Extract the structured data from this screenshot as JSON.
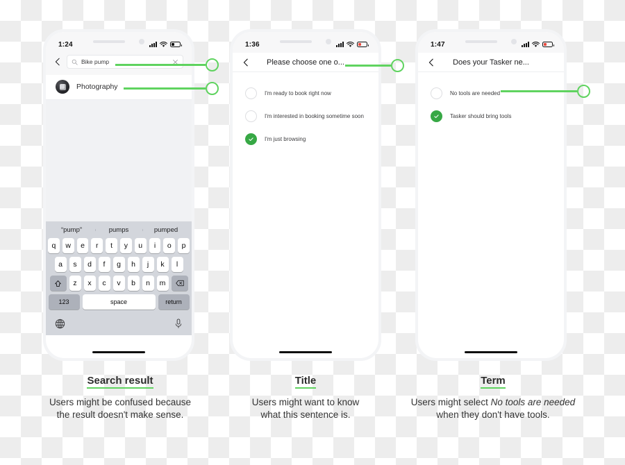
{
  "annotation_color": "#5fd35f",
  "phones": [
    {
      "id": "phone-search",
      "status": {
        "time": "1:24",
        "battery_color": "#111111"
      },
      "search": {
        "value": "Bike pump",
        "placeholder": "Search",
        "back_icon": "chevron-left-icon",
        "search_icon": "search-icon",
        "clear_icon": "close-icon"
      },
      "result": {
        "label": "Photography",
        "avatar_icon": "camera-avatar-icon"
      },
      "keyboard": {
        "predictions": [
          "“pump”",
          "pumps",
          "pumped"
        ],
        "row1": [
          "q",
          "w",
          "e",
          "r",
          "t",
          "y",
          "u",
          "i",
          "o",
          "p"
        ],
        "row2": [
          "a",
          "s",
          "d",
          "f",
          "g",
          "h",
          "j",
          "k",
          "l"
        ],
        "row3": [
          "z",
          "x",
          "c",
          "v",
          "b",
          "n",
          "m"
        ],
        "shift_icon": "shift-icon",
        "backspace_icon": "backspace-icon",
        "numbers_key": "123",
        "space_key": "space",
        "return_key": "return",
        "globe_icon": "globe-icon",
        "mic_icon": "microphone-icon"
      }
    },
    {
      "id": "phone-choose-one",
      "status": {
        "time": "1:36",
        "battery_color": "#e8483c"
      },
      "nav": {
        "title": "Please choose one o...",
        "back_icon": "chevron-left-icon"
      },
      "options": [
        {
          "label": "I'm ready to book right now",
          "checked": false
        },
        {
          "label": "I'm interested in booking sometime soon",
          "checked": false
        },
        {
          "label": "I'm just browsing",
          "checked": true
        }
      ]
    },
    {
      "id": "phone-tasker-tools",
      "status": {
        "time": "1:47",
        "battery_color": "#e8483c"
      },
      "nav": {
        "title": "Does your Tasker ne...",
        "back_icon": "chevron-left-icon"
      },
      "options": [
        {
          "label": "No tools are needed",
          "checked": false
        },
        {
          "label": "Tasker should bring tools",
          "checked": true
        }
      ]
    }
  ],
  "captions": [
    {
      "heading": "Search result",
      "line1": "Users might be confused because",
      "line2": "the result doesn't make sense."
    },
    {
      "heading": "Title",
      "line1": "Users might want to know",
      "line2": "what this sentence is."
    },
    {
      "heading": "Term",
      "line1_pre": "Users might select ",
      "line1_em": "No tools are needed",
      "line2": "when they don't have tools."
    }
  ]
}
